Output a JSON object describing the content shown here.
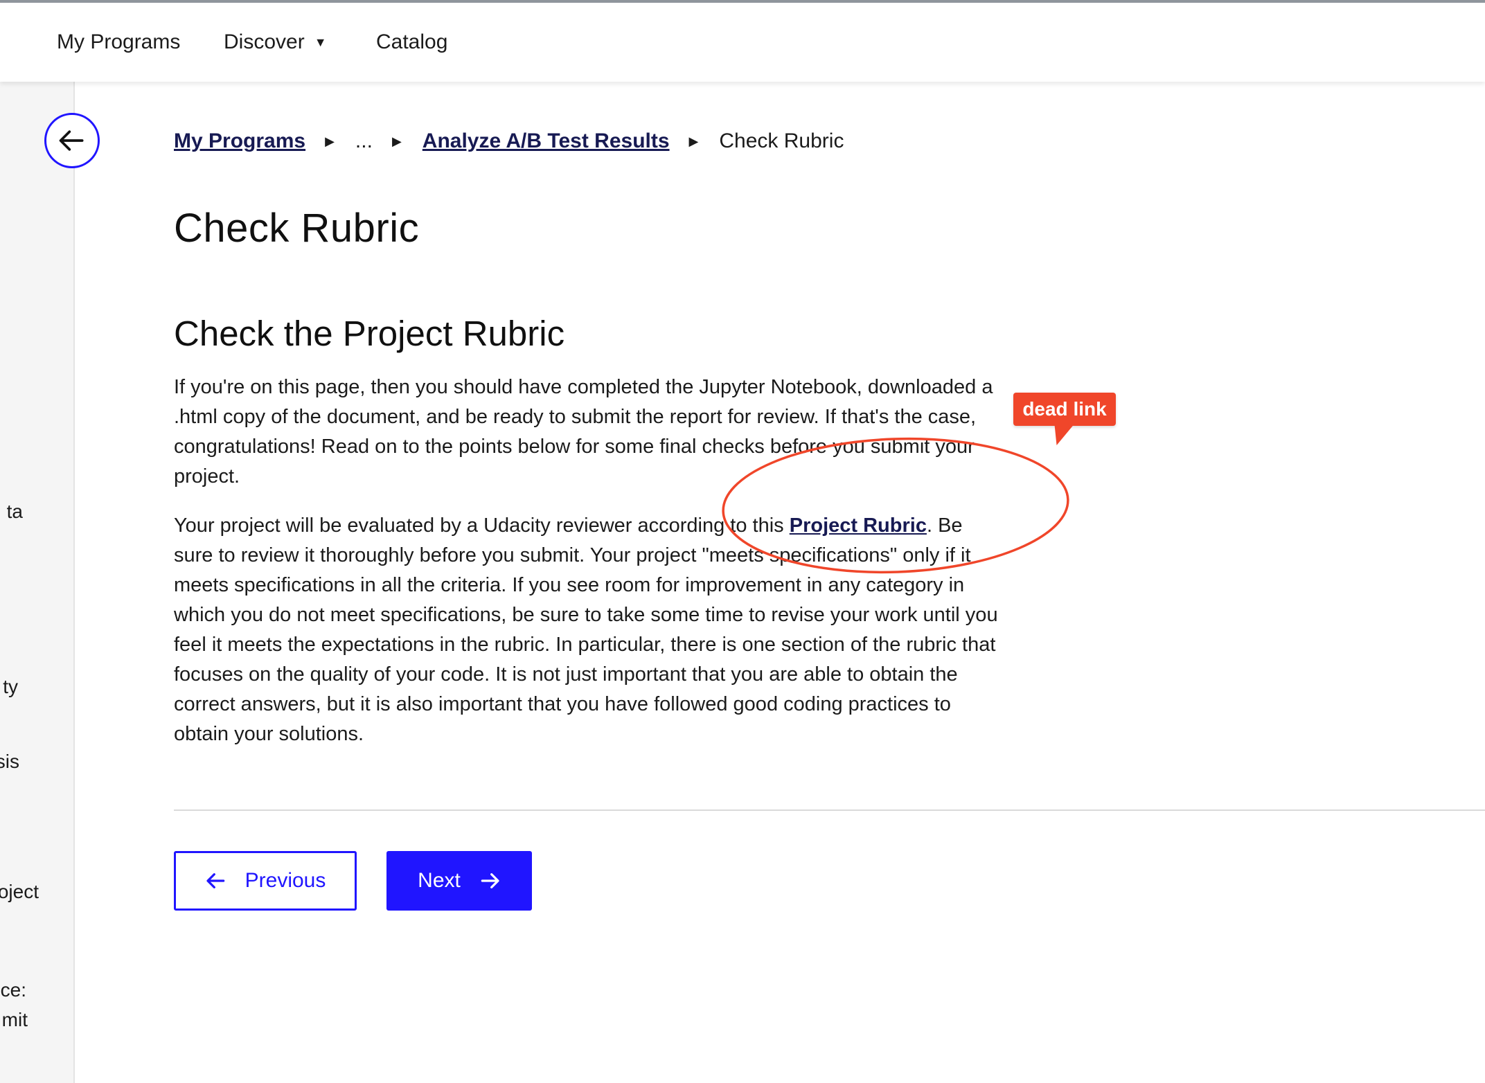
{
  "topnav": {
    "items": [
      {
        "label": "My Programs"
      },
      {
        "label": "Discover",
        "caret": "▼"
      },
      {
        "label": "Catalog"
      }
    ]
  },
  "sidebar": {
    "visible_labels": [
      "ta",
      "ty",
      "sis",
      "oject",
      "ce:",
      "mit"
    ]
  },
  "breadcrumb": {
    "items": [
      {
        "label": "My Programs",
        "link": true
      },
      {
        "label": "...",
        "link": false
      },
      {
        "label": "Analyze A/B Test Results",
        "link": true
      },
      {
        "label": "Check Rubric",
        "link": false
      }
    ],
    "separator": "▶"
  },
  "page": {
    "title": "Check Rubric",
    "section_title": "Check the Project Rubric",
    "paragraph1": "If you're on this page, then you should have completed the Jupyter Notebook, downloaded a .html copy of the document, and be ready to submit the report for review. If that's the case, congratulations! Read on to the points below for some final checks before you submit your project.",
    "paragraph2_before": "Your project will be evaluated by a Udacity reviewer according to this ",
    "paragraph2_link": "Project Rubric",
    "paragraph2_after": ". Be sure to review it thoroughly before you submit. Your project \"meets specifications\" only if it meets specifications in all the criteria. If you see room for improvement in any category in which you do not meet specifications, be sure to take some time to revise your work until you feel it meets the expectations in the rubric. In particular, there is one section of the rubric that focuses on the quality of your code. It is not just important that you are able to obtain the correct answers, but it is also important that you have followed good coding practices to obtain your solutions."
  },
  "navigation": {
    "previous_label": "Previous",
    "next_label": "Next"
  },
  "annotation": {
    "label": "dead link",
    "color": "#f0462a"
  },
  "colors": {
    "accent": "#2015ff",
    "link": "#171a53"
  },
  "icons": {
    "back": "arrow-left-icon",
    "previous": "arrow-left-icon",
    "next": "arrow-right-icon"
  }
}
